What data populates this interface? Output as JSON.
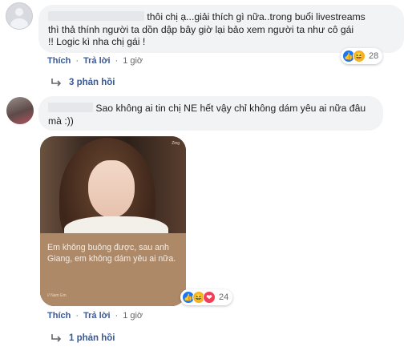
{
  "comments": [
    {
      "text_lines": [
        "thôi chị ạ...giải thích gì nữa..trong buổi livestreams",
        "thì thả thính người ta dồn dập bây giờ lại bảo xem người ta như cô gái",
        "!! Logic kì nha chị gái !"
      ],
      "actions": {
        "like": "Thích",
        "reply": "Trả lời",
        "time": "1 giờ"
      },
      "reactions": {
        "icons": [
          "like-icon",
          "haha-icon"
        ],
        "count": "28"
      },
      "replies_label": "3 phản hồi"
    },
    {
      "text_lines": [
        "Sao không ai tin chị NE hết vậy chỉ không dám yêu ai nữa đâu",
        "mà :))"
      ],
      "image": {
        "caption": "Em không buông được, sau anh Giang, em không dám yêu ai nữa.",
        "watermark": "Zing",
        "credit": "// Nam Em"
      },
      "actions": {
        "like": "Thích",
        "reply": "Trả lời",
        "time": "1 giờ"
      },
      "reactions": {
        "icons": [
          "like-icon",
          "haha-icon",
          "love-icon"
        ],
        "count": "24"
      },
      "replies_label": "1 phản hồi"
    }
  ],
  "colors": {
    "link": "#385898",
    "bubble": "#f2f3f5",
    "like": "#1877f2",
    "haha": "#f7b125",
    "love": "#f33e58"
  }
}
